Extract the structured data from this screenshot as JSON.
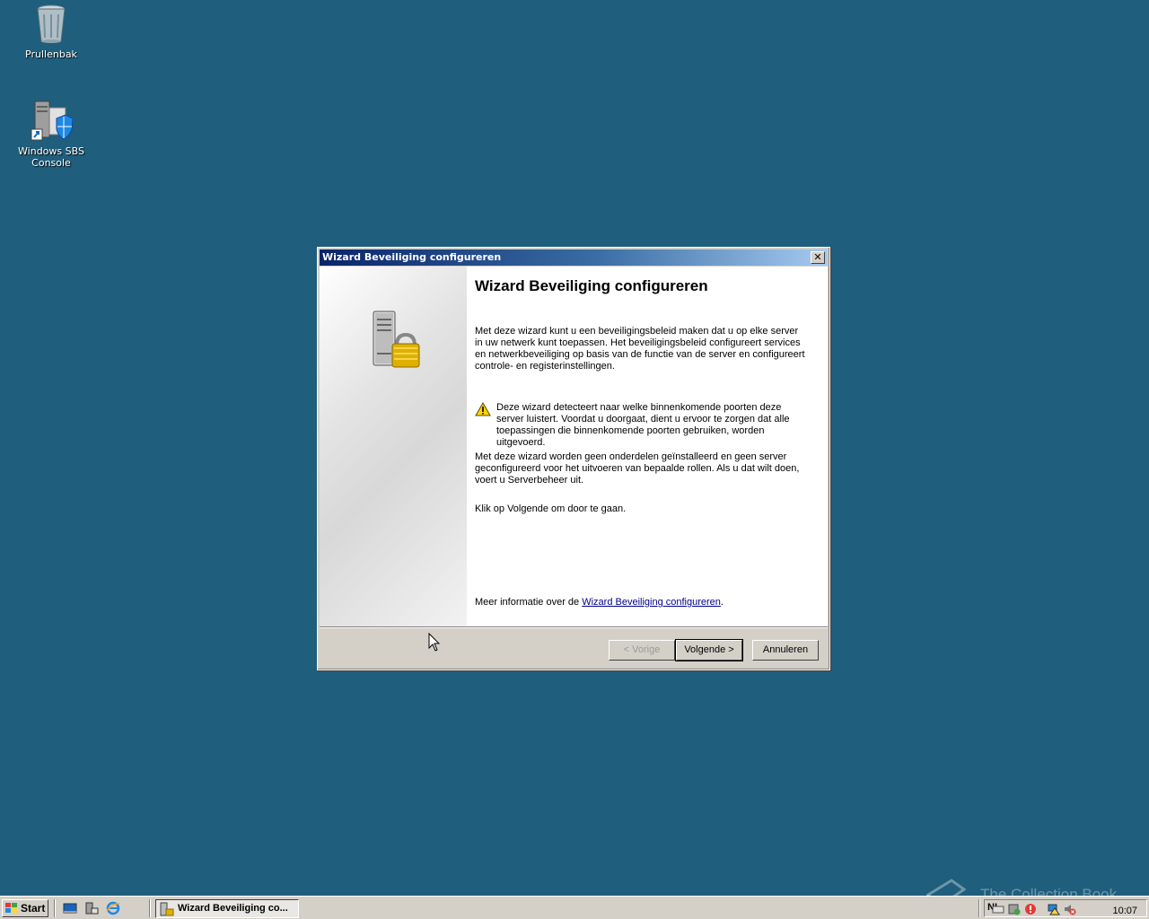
{
  "desktop": {
    "icons": [
      {
        "label": "Prullenbak"
      },
      {
        "label": "Windows SBS Console"
      }
    ]
  },
  "dialog": {
    "title": "Wizard Beveiliging configureren",
    "heading": "Wizard Beveiliging configureren",
    "intro": "Met deze wizard kunt u een beveiligingsbeleid maken dat u op elke server in uw netwerk kunt toepassen. Het beveiligingsbeleid configureert services en netwerkbeveiliging op basis van de functie van de server en configureert controle- en registerinstellingen.",
    "warning": "Deze wizard detecteert naar welke binnenkomende poorten deze server luistert. Voordat u doorgaat, dient u ervoor te zorgen dat alle toepassingen die binnenkomende poorten gebruiken, worden uitgevoerd.",
    "note": "Met deze wizard worden geen onderdelen geïnstalleerd en geen server geconfigureerd voor het uitvoeren van bepaalde rollen. Als u dat wilt doen, voert u Serverbeheer uit.",
    "instruction": "Klik op Volgende om door te gaan.",
    "more_info_prefix": "Meer informatie over de ",
    "more_info_link": "Wizard Beveiliging configureren",
    "more_info_suffix": ".",
    "buttons": {
      "back": "< Vorige",
      "next": "Volgende >",
      "cancel": "Annuleren"
    }
  },
  "taskbar": {
    "start_label": "Start",
    "task_label": "Wizard Beveiliging co...",
    "language": "NL",
    "clock": "10:07"
  },
  "watermark": "The Collection Book",
  "colors": {
    "desktop": "#1f5e7c",
    "titlebar_start": "#0a246a",
    "titlebar_end": "#a6caf0",
    "face": "#d4d0c8"
  }
}
